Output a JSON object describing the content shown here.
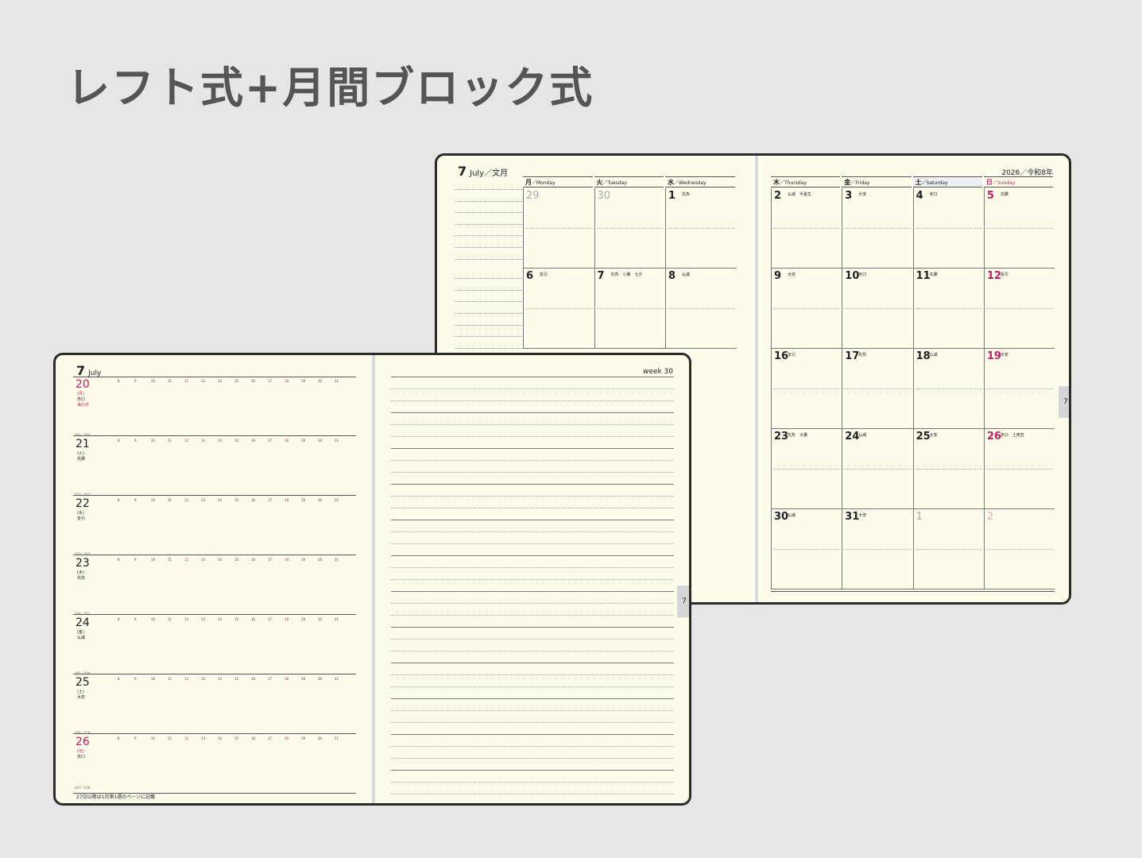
{
  "title": "レフト式+月間ブロック式",
  "monthly": {
    "month_num": "7",
    "month_label": "July／文月",
    "year_label": "2026／令和8年",
    "tab": "7",
    "weekdays_left": [
      {
        "jp": "月",
        "en": "／Monday"
      },
      {
        "jp": "火",
        "en": "／Tuesday"
      },
      {
        "jp": "水",
        "en": "／Wednesday"
      }
    ],
    "weekdays_right": [
      {
        "jp": "木",
        "en": "／Thursday"
      },
      {
        "jp": "金",
        "en": "／Friday"
      },
      {
        "jp": "土",
        "en": "／Saturday"
      },
      {
        "jp": "日",
        "en": "／Sunday"
      }
    ],
    "left_rows": [
      [
        {
          "n": "29",
          "r": "",
          "dim": true
        },
        {
          "n": "30",
          "r": "",
          "dim": true
        },
        {
          "n": "1",
          "r": "先負"
        }
      ],
      [
        {
          "n": "6",
          "r": "友引"
        },
        {
          "n": "7",
          "r": "先負　小暑　七夕"
        },
        {
          "n": "8",
          "r": "仏滅"
        }
      ]
    ],
    "right_rows": [
      [
        {
          "n": "2",
          "r": "仏滅　半夏生"
        },
        {
          "n": "3",
          "r": "大安"
        },
        {
          "n": "4",
          "r": "赤口"
        },
        {
          "n": "5",
          "r": "先勝",
          "sun": true
        }
      ],
      [
        {
          "n": "9",
          "r": "大安"
        },
        {
          "n": "10",
          "r": "赤口"
        },
        {
          "n": "11",
          "r": "先勝"
        },
        {
          "n": "12",
          "r": "友引",
          "sun": true
        }
      ],
      [
        {
          "n": "16",
          "r": "友引"
        },
        {
          "n": "17",
          "r": "先負"
        },
        {
          "n": "18",
          "r": "仏滅"
        },
        {
          "n": "19",
          "r": "大安",
          "sun": true
        }
      ],
      [
        {
          "n": "23",
          "r": "先負　大暑"
        },
        {
          "n": "24",
          "r": "仏滅"
        },
        {
          "n": "25",
          "r": "大安"
        },
        {
          "n": "26",
          "r": "赤口　土用丑",
          "sun": true
        }
      ],
      [
        {
          "n": "30",
          "r": "仏滅"
        },
        {
          "n": "31",
          "r": "大安"
        },
        {
          "n": "1",
          "r": "",
          "dim": true
        },
        {
          "n": "2",
          "r": "",
          "dim": true,
          "sun": true
        }
      ]
    ]
  },
  "weekly": {
    "month_num": "7",
    "month_label": "July",
    "week_label": "week 30",
    "tab": "7",
    "hours": [
      "8",
      "9",
      "10",
      "11",
      "12",
      "13",
      "14",
      "15",
      "16",
      "17",
      "18",
      "19",
      "20",
      "21"
    ],
    "days": [
      {
        "num": "20",
        "dow": "(月)",
        "rokuyo": "赤口",
        "holiday": "海の日",
        "sun": true,
        "sr": ""
      },
      {
        "num": "21",
        "dow": "(火)",
        "rokuyo": "先勝",
        "holiday": "",
        "sun": false,
        "sr": "201／164"
      },
      {
        "num": "22",
        "dow": "(水)",
        "rokuyo": "友引",
        "holiday": "",
        "sun": false,
        "sr": "202／163"
      },
      {
        "num": "23",
        "dow": "(木)",
        "rokuyo": "先負",
        "holiday": "",
        "sun": false,
        "sr": "203／162"
      },
      {
        "num": "24",
        "dow": "(金)",
        "rokuyo": "仏滅",
        "holiday": "",
        "sun": false,
        "sr": "204／161"
      },
      {
        "num": "25",
        "dow": "(土)",
        "rokuyo": "大安",
        "holiday": "",
        "sun": false,
        "sr": "205／160"
      },
      {
        "num": "26",
        "dow": "(日)",
        "rokuyo": "赤口",
        "holiday": "",
        "sun": true,
        "sr": "206／159"
      }
    ],
    "last_sr": "207／158",
    "footer": "27日以降は1月第1週のページに記載"
  }
}
